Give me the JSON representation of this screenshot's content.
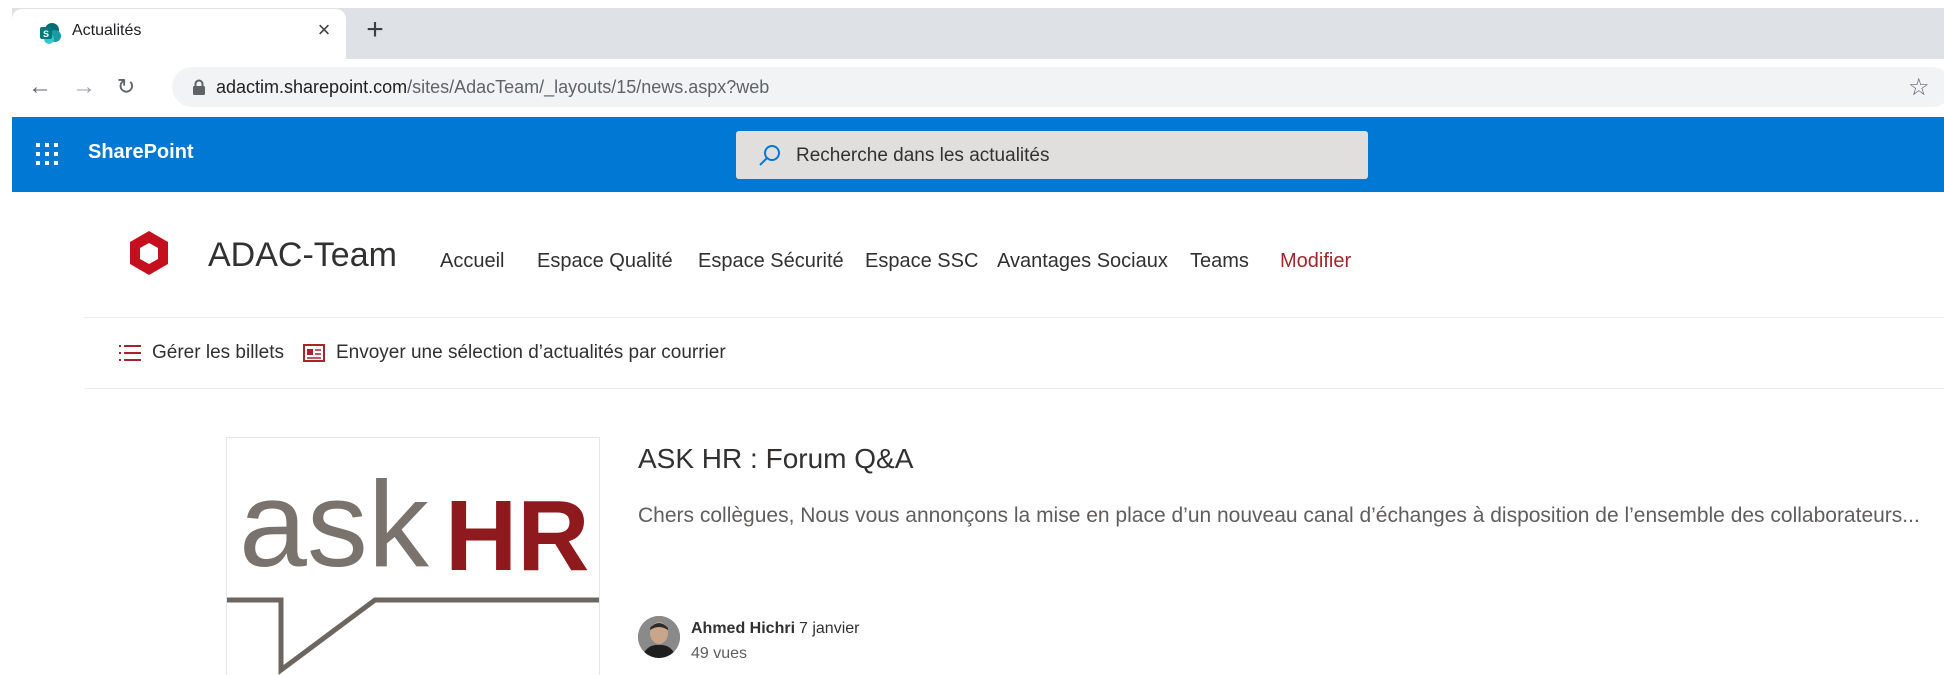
{
  "browser": {
    "tab_title": "Actualités",
    "url_host": "adactim.sharepoint.com",
    "url_path": "/sites/AdacTeam/_layouts/15/news.aspx?web"
  },
  "suite_bar": {
    "brand": "SharePoint",
    "search_placeholder": "Recherche dans les actualités",
    "color": "#0078d4"
  },
  "site": {
    "title": "ADAC-Team",
    "nav": [
      {
        "label": "Accueil"
      },
      {
        "label": "Espace Qualité"
      },
      {
        "label": "Espace Sécurité"
      },
      {
        "label": "Espace SSC"
      },
      {
        "label": "Avantages Sociaux"
      },
      {
        "label": "Teams"
      },
      {
        "label": "Modifier"
      }
    ]
  },
  "command_bar": {
    "manage_posts": "Gérer les billets",
    "send_digest": "Envoyer une sélection d’actualités par courrier"
  },
  "news": [
    {
      "thumbnail_text_1": "ask",
      "thumbnail_text_2": "HR",
      "title": "ASK HR : Forum Q&A",
      "description": "Chers collègues, Nous vous annonçons la mise en place d’un nouveau canal d’échanges à disposition de l’ensemble des collaborateurs...",
      "author": "Ahmed Hichri",
      "date": "7 janvier",
      "views": "49 vues"
    }
  ],
  "icons": [
    "sharepoint-favicon",
    "close-icon",
    "plus-icon",
    "back-arrow-icon",
    "forward-arrow-icon",
    "reload-icon",
    "lock-icon",
    "star-icon",
    "waffle-icon",
    "search-icon",
    "list-icon",
    "newsletter-icon"
  ]
}
